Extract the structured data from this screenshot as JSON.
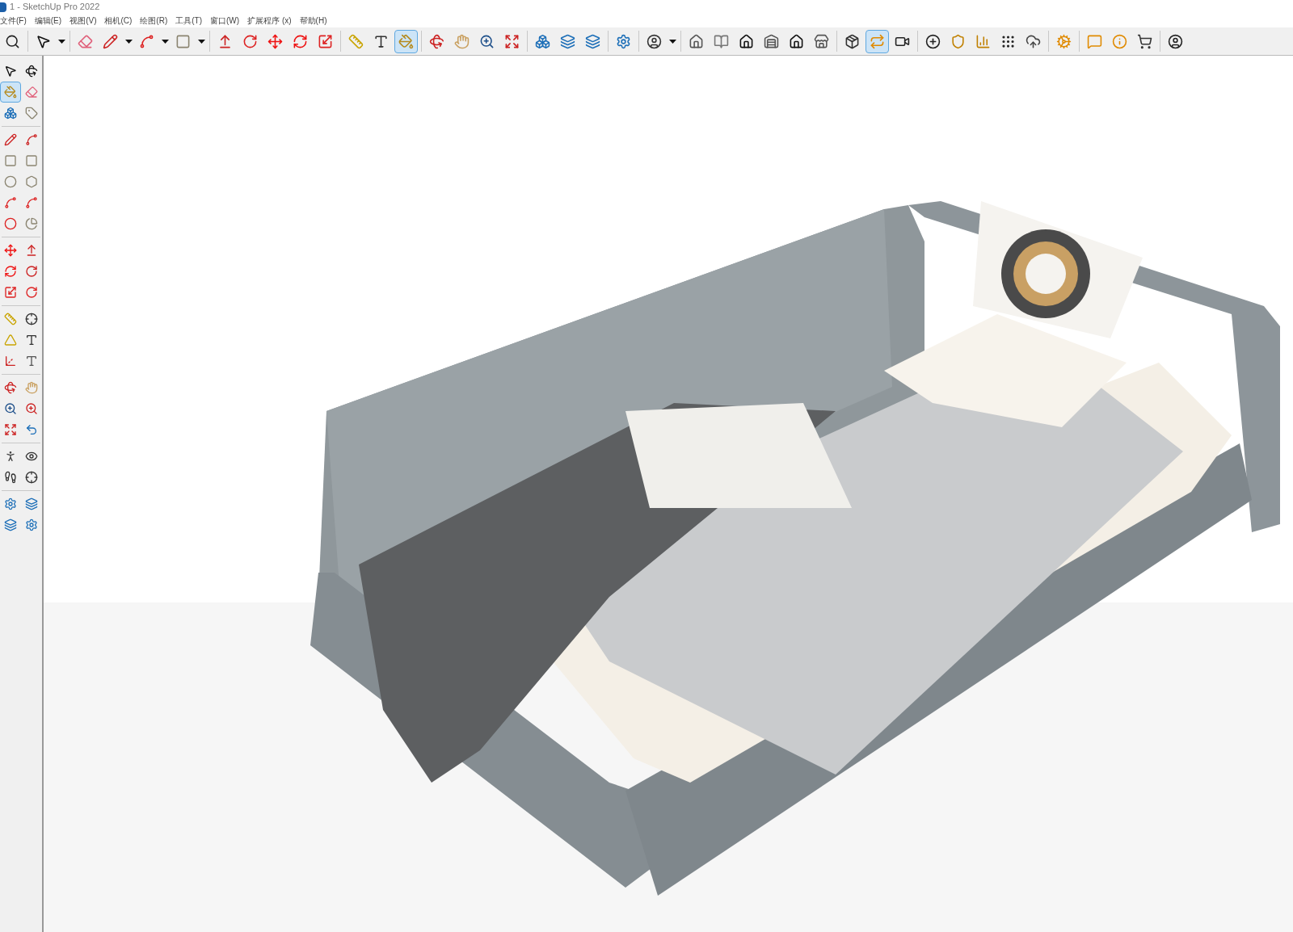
{
  "window": {
    "title": "1 - SketchUp Pro 2022"
  },
  "menu": [
    "文件(F)",
    "编辑(E)",
    "视图(V)",
    "相机(C)",
    "绘图(R)",
    "工具(T)",
    "窗口(W)",
    "扩展程序 (x)",
    "帮助(H)"
  ],
  "toolbar": {
    "tools": [
      {
        "selected": false
      },
      {
        "selected": false
      },
      {
        "selected": false
      },
      {
        "selected": false
      },
      {
        "selected": false
      },
      {
        "selected": false
      },
      {
        "selected": false
      },
      {
        "selected": false
      },
      {
        "selected": false
      },
      {
        "selected": false
      },
      {
        "selected": false
      },
      {
        "selected": false
      },
      {
        "selected": false
      },
      {
        "selected": false
      },
      {
        "selected": false
      },
      {
        "selected": false
      },
      {
        "selected": false
      },
      {
        "selected": true
      },
      {
        "selected": false
      },
      {
        "selected": false
      },
      {
        "selected": false
      },
      {
        "selected": false
      },
      {
        "selected": false
      },
      {
        "selected": false
      },
      {
        "selected": false
      },
      {
        "selected": false
      },
      {
        "selected": false
      },
      {
        "selected": false
      },
      {
        "selected": false
      },
      {
        "selected": false
      },
      {
        "selected": false
      },
      {
        "selected": false
      },
      {
        "selected": false
      },
      {
        "selected": false
      },
      {
        "selected": false
      },
      {
        "selected": true
      },
      {
        "selected": false
      },
      {
        "selected": false
      },
      {
        "selected": false
      },
      {
        "selected": false
      },
      {
        "selected": false
      },
      {
        "selected": false
      },
      {
        "selected": false
      },
      {
        "selected": false
      },
      {
        "selected": false
      },
      {
        "selected": false
      },
      {
        "selected": false
      }
    ]
  },
  "left_toolbar": {
    "tools": [
      {
        "selected": false
      },
      {
        "selected": false
      },
      {
        "selected": true
      },
      {
        "selected": false
      },
      {
        "selected": false
      },
      {
        "selected": false
      },
      {
        "selected": false
      },
      {
        "selected": false
      },
      {
        "selected": false
      },
      {
        "selected": false
      },
      {
        "selected": false
      },
      {
        "selected": false
      },
      {
        "selected": false
      },
      {
        "selected": false
      },
      {
        "selected": false
      },
      {
        "selected": false
      },
      {
        "selected": false
      },
      {
        "selected": false
      },
      {
        "selected": false
      },
      {
        "selected": false
      },
      {
        "selected": false
      },
      {
        "selected": false
      },
      {
        "selected": false
      },
      {
        "selected": false
      },
      {
        "selected": false
      },
      {
        "selected": false
      },
      {
        "selected": false
      },
      {
        "selected": false
      },
      {
        "selected": false
      },
      {
        "selected": false
      },
      {
        "selected": false
      },
      {
        "selected": false
      },
      {
        "selected": false
      },
      {
        "selected": false
      },
      {
        "selected": false
      },
      {
        "selected": false
      },
      {
        "selected": false
      },
      {
        "selected": false
      },
      {
        "selected": false
      },
      {
        "selected": false
      },
      {
        "selected": false
      },
      {
        "selected": false
      }
    ]
  }
}
